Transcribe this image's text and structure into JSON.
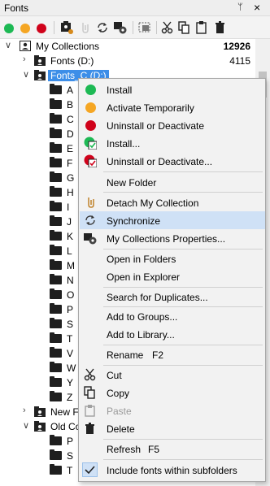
{
  "title_bar": {
    "title": "Fonts",
    "pin_glyph": "ᛘ",
    "close_glyph": "×"
  },
  "toolbar": {
    "buttons": [
      {
        "name": "activate-icon",
        "color": "#1db954"
      },
      {
        "name": "activate-temporarily-icon",
        "color": "#f5a623"
      },
      {
        "name": "deactivate-icon",
        "color": "#d0021b"
      },
      {
        "name": "collection-properties-icon"
      },
      {
        "name": "detach-collection-icon"
      },
      {
        "name": "synchronize-icon"
      },
      {
        "name": "settings-icon"
      },
      {
        "name": "add-to-groups-icon"
      },
      {
        "name": "cut-icon"
      },
      {
        "name": "copy-icon"
      },
      {
        "name": "paste-icon"
      },
      {
        "name": "delete-icon"
      }
    ]
  },
  "tree": {
    "root": {
      "label": "My Collections",
      "count": "12926"
    },
    "fonts_d": {
      "label": "Fonts (D:)",
      "count": "4115"
    },
    "fonts_c": {
      "label": "Fonts_C (D:)"
    },
    "letters": [
      "A",
      "B",
      "C",
      "D",
      "E",
      "F",
      "G",
      "H",
      "I",
      "J",
      "K",
      "L",
      "M",
      "N",
      "O",
      "P",
      "S",
      "T",
      "V",
      "W",
      "Y",
      "Z"
    ],
    "new_f": {
      "label": "New F"
    },
    "old_c": {
      "label": "Old Co"
    },
    "old_c_letters": [
      "P",
      "S",
      "T"
    ]
  },
  "context_menu": {
    "items": [
      {
        "label": "Install",
        "icon": "green-dot-icon"
      },
      {
        "label": "Activate Temporarily",
        "icon": "orange-dot-icon"
      },
      {
        "label": "Uninstall or Deactivate",
        "icon": "red-dot-icon"
      },
      {
        "label": "Install...",
        "icon": "install-check-icon"
      },
      {
        "label": "Uninstall or Deactivate...",
        "icon": "uninstall-check-icon"
      },
      {
        "label": "New Folder"
      },
      {
        "label": "Detach My Collection",
        "icon": "detach-icon"
      },
      {
        "label": "Synchronize",
        "icon": "synchronize-icon"
      },
      {
        "label": "My Collections Properties...",
        "icon": "properties-icon"
      },
      {
        "label": "Open in Folders"
      },
      {
        "label": "Open in Explorer"
      },
      {
        "label": "Search for Duplicates..."
      },
      {
        "label": "Add to Groups..."
      },
      {
        "label": "Add to Library..."
      },
      {
        "label": "Rename",
        "shortcut": "F2"
      },
      {
        "label": "Cut",
        "icon": "cut-icon"
      },
      {
        "label": "Copy",
        "icon": "copy-icon"
      },
      {
        "label": "Paste",
        "icon": "paste-icon",
        "disabled": true
      },
      {
        "label": "Delete",
        "icon": "delete-icon"
      },
      {
        "label": "Refresh",
        "shortcut": "F5"
      },
      {
        "label": "Include fonts within subfolders",
        "icon": "checkmark-icon",
        "checked": true
      }
    ]
  },
  "colors": {
    "selection": "#3d8ee8",
    "menu_highlight": "#cfe1f6",
    "menu_background": "#f2f2f2",
    "green": "#1db954",
    "orange": "#f5a623",
    "red": "#d0021b"
  }
}
